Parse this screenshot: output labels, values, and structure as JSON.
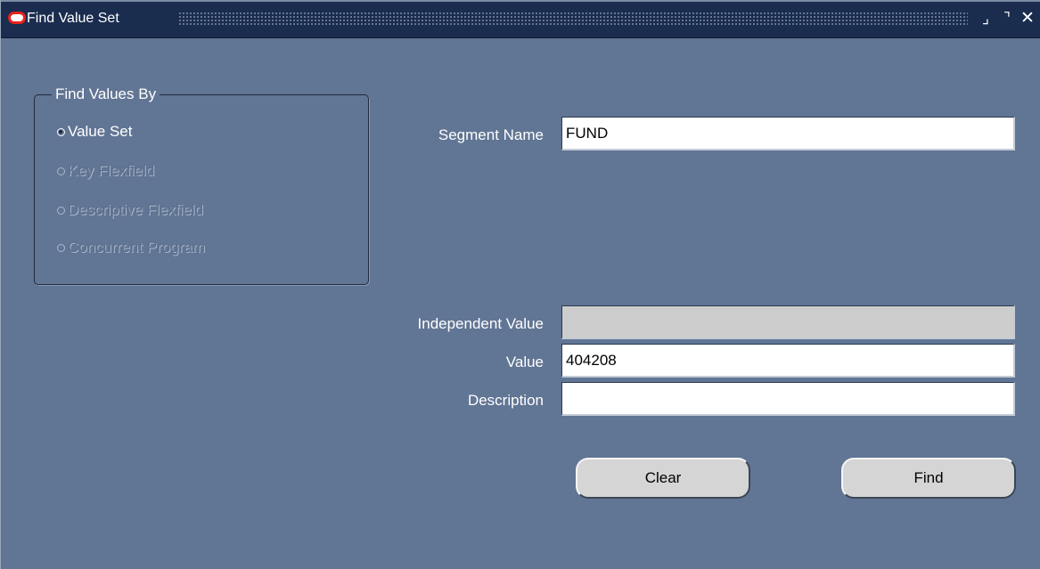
{
  "window": {
    "title": "Find Value Set",
    "minimize_glyph": "⌟",
    "maximize_glyph": "⌝",
    "close_glyph": "✕"
  },
  "find_values_by": {
    "title": "Find Values By",
    "options": [
      {
        "label": "Value Set",
        "checked": true,
        "enabled": true
      },
      {
        "label": "Key Flexfield",
        "checked": false,
        "enabled": false
      },
      {
        "label": "Descriptive Flexfield",
        "checked": false,
        "enabled": false
      },
      {
        "label": "Concurrent Program",
        "checked": false,
        "enabled": false
      }
    ]
  },
  "fields": {
    "segment_name": {
      "label": "Segment Name",
      "value": "FUND"
    },
    "independent_value": {
      "label": "Independent Value",
      "value": ""
    },
    "value": {
      "label": "Value",
      "value": "404208"
    },
    "description": {
      "label": "Description",
      "value": ""
    }
  },
  "buttons": {
    "clear_label": "Clear",
    "find_label": "Find"
  },
  "colors": {
    "window_background": "#617594",
    "titlebar_background": "#1a2d4f",
    "oracle_red": "#e8221b"
  },
  "icons": {
    "app": "oracle-logo-icon",
    "minimize": "minimize-icon",
    "maximize": "maximize-icon",
    "close": "close-icon"
  }
}
